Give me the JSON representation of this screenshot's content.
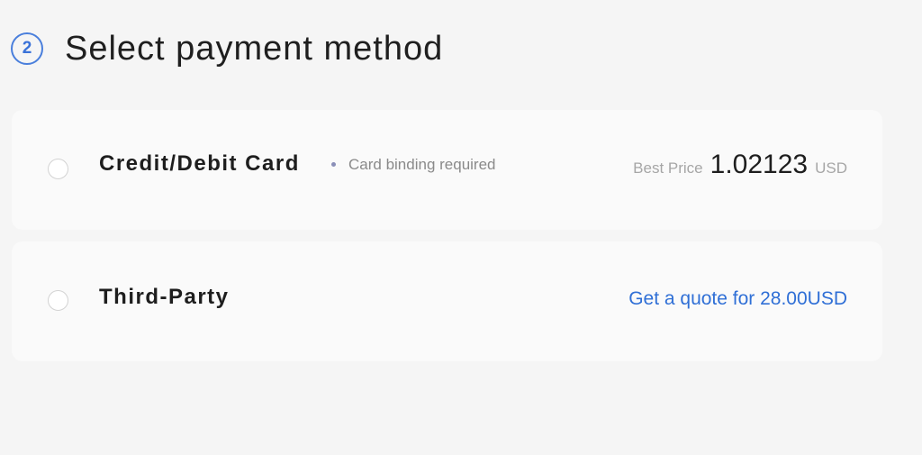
{
  "section": {
    "step_number": "2",
    "title": "Select payment method"
  },
  "options": [
    {
      "title": "Credit/Debit Card",
      "note": "Card binding required",
      "price_label": "Best Price",
      "price_value": "1.02123",
      "price_currency": "USD",
      "selected": false
    },
    {
      "title": "Third-Party",
      "quote_link": "Get a quote for 28.00USD",
      "selected": false
    }
  ],
  "colors": {
    "background": "#f5f5f5",
    "card": "#fafafa",
    "accent": "#2f6fd6",
    "muted_text": "#a6a6a6"
  }
}
